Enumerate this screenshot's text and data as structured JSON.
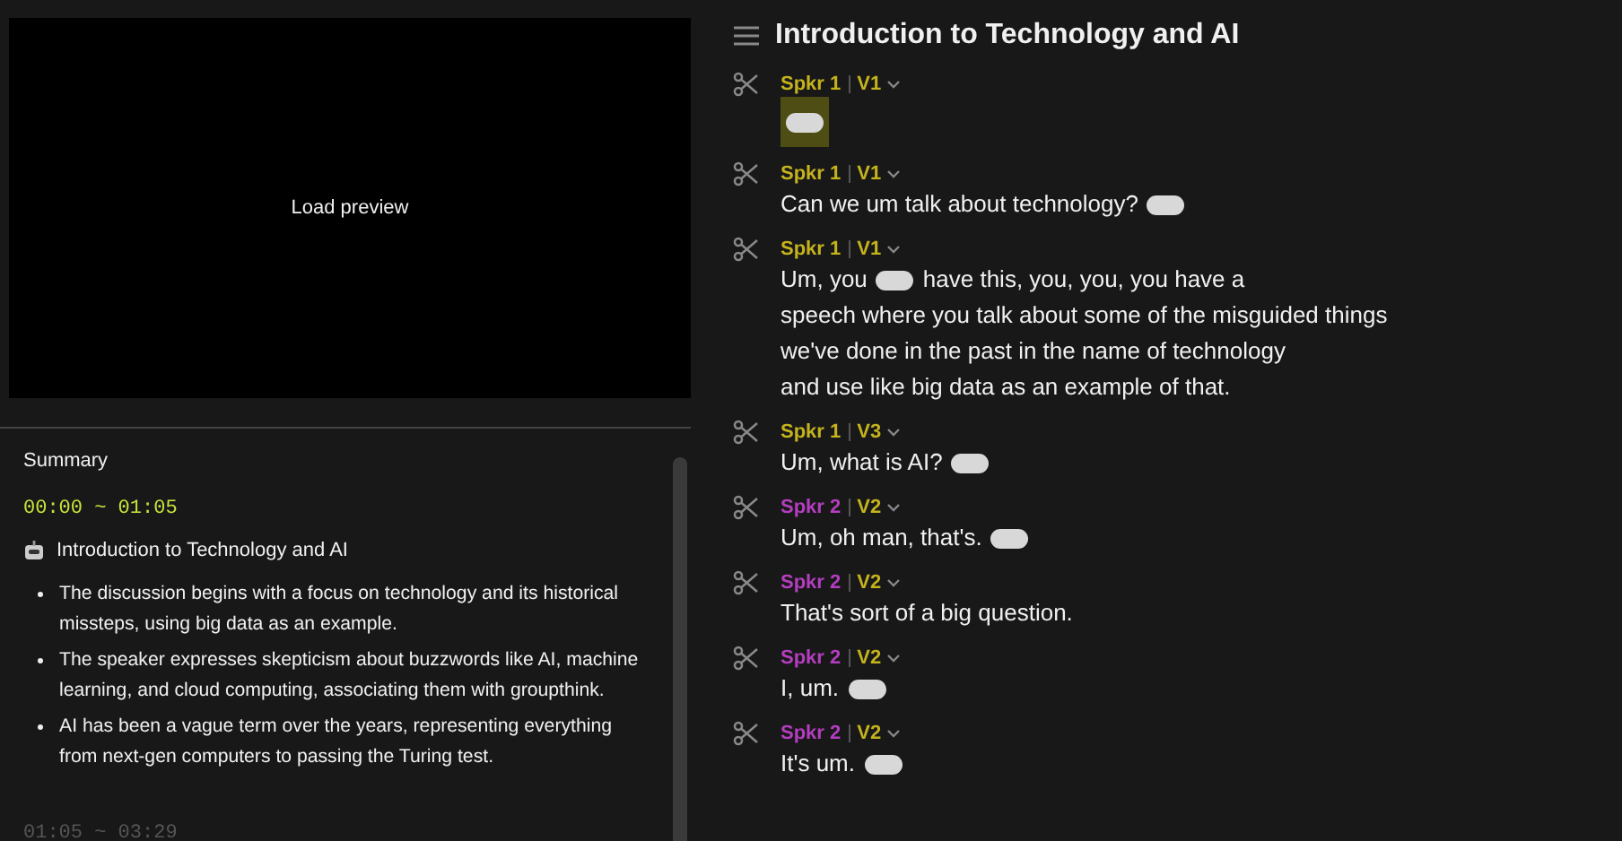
{
  "preview": {
    "label": "Load preview"
  },
  "summary": {
    "title": "Summary",
    "sections": [
      {
        "time": "00:00 ~ 01:05",
        "topic": "Introduction to Technology and AI",
        "bullets": [
          "The discussion begins with a focus on technology and its historical missteps, using big data as an example.",
          "The speaker expresses skepticism about buzzwords like AI, machine learning, and cloud computing, associating them with groupthink.",
          "AI has been a vague term over the years, representing everything from next-gen computers to passing the Turing test."
        ]
      },
      {
        "time": "01:05 ~ 03:29"
      }
    ]
  },
  "transcript": {
    "title": "Introduction to Technology and AI",
    "segments": [
      {
        "speaker": "Spkr 1",
        "color": "#c4b31c",
        "version": "V1",
        "lines": [
          [
            {
              "kind": "pause",
              "selected": true
            }
          ]
        ]
      },
      {
        "speaker": "Spkr 1",
        "color": "#c4b31c",
        "version": "V1",
        "lines": [
          [
            {
              "kind": "text",
              "text": "Can we um talk about technology?"
            },
            {
              "kind": "pause",
              "selected": false
            }
          ]
        ]
      },
      {
        "speaker": "Spkr 1",
        "color": "#c4b31c",
        "version": "V1",
        "lines": [
          [
            {
              "kind": "text",
              "text": "Um, you"
            },
            {
              "kind": "pause",
              "selected": false
            },
            {
              "kind": "text",
              "text": "have this, you, you, you have a"
            }
          ],
          [
            {
              "kind": "text",
              "text": "speech where you talk about some of the misguided things"
            }
          ],
          [
            {
              "kind": "text",
              "text": "we've done in the past in the name of technology"
            }
          ],
          [
            {
              "kind": "text",
              "text": "and use like big data as an example of that."
            }
          ]
        ]
      },
      {
        "speaker": "Spkr 1",
        "color": "#c4b31c",
        "version": "V3",
        "lines": [
          [
            {
              "kind": "text",
              "text": "Um, what is AI?"
            },
            {
              "kind": "pause",
              "selected": false
            }
          ]
        ]
      },
      {
        "speaker": "Spkr 2",
        "color": "#b43dc0",
        "version": "V2",
        "lines": [
          [
            {
              "kind": "text",
              "text": "Um, oh man, that's."
            },
            {
              "kind": "pause",
              "selected": false
            }
          ]
        ]
      },
      {
        "speaker": "Spkr 2",
        "color": "#b43dc0",
        "version": "V2",
        "lines": [
          [
            {
              "kind": "text",
              "text": "That's sort of a big question."
            }
          ]
        ]
      },
      {
        "speaker": "Spkr 2",
        "color": "#b43dc0",
        "version": "V2",
        "lines": [
          [
            {
              "kind": "text",
              "text": "I, um."
            },
            {
              "kind": "pause",
              "selected": false
            }
          ]
        ]
      },
      {
        "speaker": "Spkr 2",
        "color": "#b43dc0",
        "version": "V2",
        "lines": [
          [
            {
              "kind": "text",
              "text": "It's um."
            },
            {
              "kind": "pause",
              "selected": false
            }
          ]
        ]
      }
    ]
  }
}
